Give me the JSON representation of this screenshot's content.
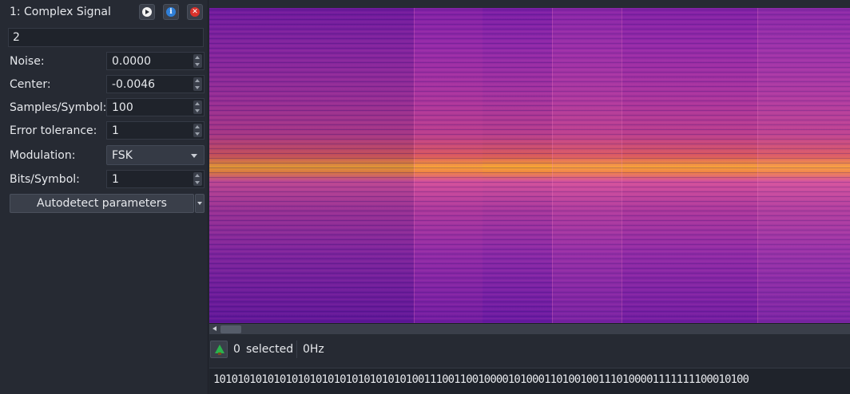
{
  "signal": {
    "index": "1:",
    "name": "Complex Signal",
    "name_field": "2"
  },
  "header_buttons": {
    "play_icon": "play-circle-icon",
    "info_icon": "info-icon",
    "close_icon": "close-circle-icon",
    "info_glyph": "i",
    "close_glyph": "✕"
  },
  "parameters": {
    "noise": {
      "label": "Noise:",
      "value": "0.0000"
    },
    "center": {
      "label": "Center:",
      "value": "-0.0046"
    },
    "samples_per_symbol": {
      "label": "Samples/Symbol:",
      "value": "100"
    },
    "error_tolerance": {
      "label": "Error tolerance:",
      "value": "1"
    },
    "modulation": {
      "label": "Modulation:",
      "value": "FSK"
    },
    "bits_per_symbol": {
      "label": "Bits/Symbol:",
      "value": "1"
    }
  },
  "autodetect": {
    "label": "Autodetect parameters"
  },
  "selection": {
    "count": "0",
    "label": "selected",
    "frequency": "0Hz",
    "icon": "tree-icon"
  },
  "bits": "10101010101010101010101010101010100111001100100001010001101001001110100001111111100010100",
  "colors": {
    "background": "#262a33",
    "spectrogram_peak": "#f7a830",
    "spectrogram_base": "#8e28a8"
  }
}
